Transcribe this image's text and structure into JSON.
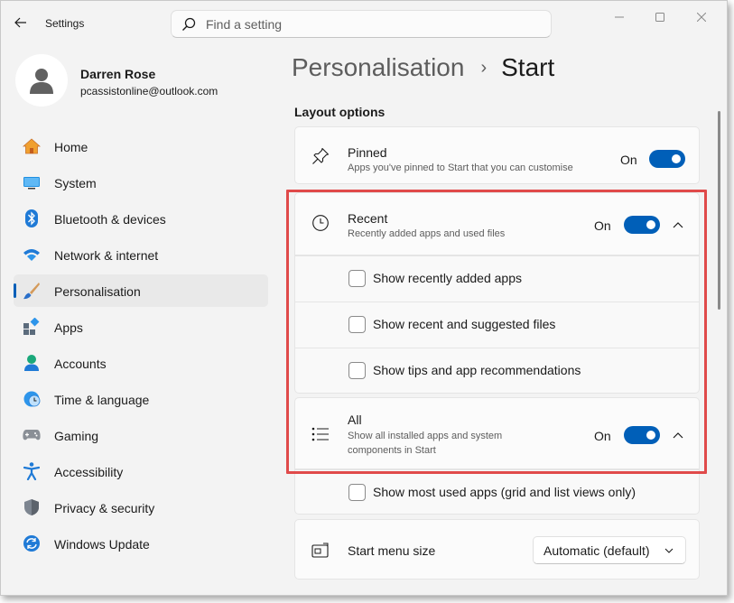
{
  "app": {
    "title": "Settings",
    "search_placeholder": "Find a setting"
  },
  "user": {
    "name": "Darren Rose",
    "email": "pcassistonline@outlook.com"
  },
  "nav": {
    "items": [
      {
        "label": "Home",
        "icon": "home-icon"
      },
      {
        "label": "System",
        "icon": "system-icon"
      },
      {
        "label": "Bluetooth & devices",
        "icon": "bluetooth-icon"
      },
      {
        "label": "Network & internet",
        "icon": "wifi-icon"
      },
      {
        "label": "Personalisation",
        "icon": "brush-icon",
        "active": true
      },
      {
        "label": "Apps",
        "icon": "apps-icon"
      },
      {
        "label": "Accounts",
        "icon": "accounts-icon"
      },
      {
        "label": "Time & language",
        "icon": "time-language-icon"
      },
      {
        "label": "Gaming",
        "icon": "gaming-icon"
      },
      {
        "label": "Accessibility",
        "icon": "accessibility-icon"
      },
      {
        "label": "Privacy & security",
        "icon": "shield-icon"
      },
      {
        "label": "Windows Update",
        "icon": "update-icon"
      }
    ]
  },
  "main": {
    "breadcrumb_parent": "Personalisation",
    "breadcrumb_separator": "›",
    "breadcrumb_current": "Start",
    "section_title": "Layout options",
    "pinned": {
      "title": "Pinned",
      "description": "Apps you've pinned to Start that you can customise",
      "state": "On"
    },
    "recent": {
      "title": "Recent",
      "description": "Recently added apps and used files",
      "state": "On",
      "options": [
        "Show recently added apps",
        "Show recent and suggested files",
        "Show tips and app recommendations"
      ]
    },
    "all": {
      "title": "All",
      "description_line1": "Show all installed apps and system",
      "description_line2": "components in Start",
      "state": "On",
      "options": [
        "Show most used apps (grid and list views only)"
      ]
    },
    "start_menu_size": {
      "title": "Start menu size",
      "value": "Automatic (default)"
    }
  },
  "colors": {
    "accent": "#005fb8",
    "highlight": "#e04a4a",
    "window_bg": "#f3f3f3",
    "card_bg": "#fbfbfb"
  }
}
